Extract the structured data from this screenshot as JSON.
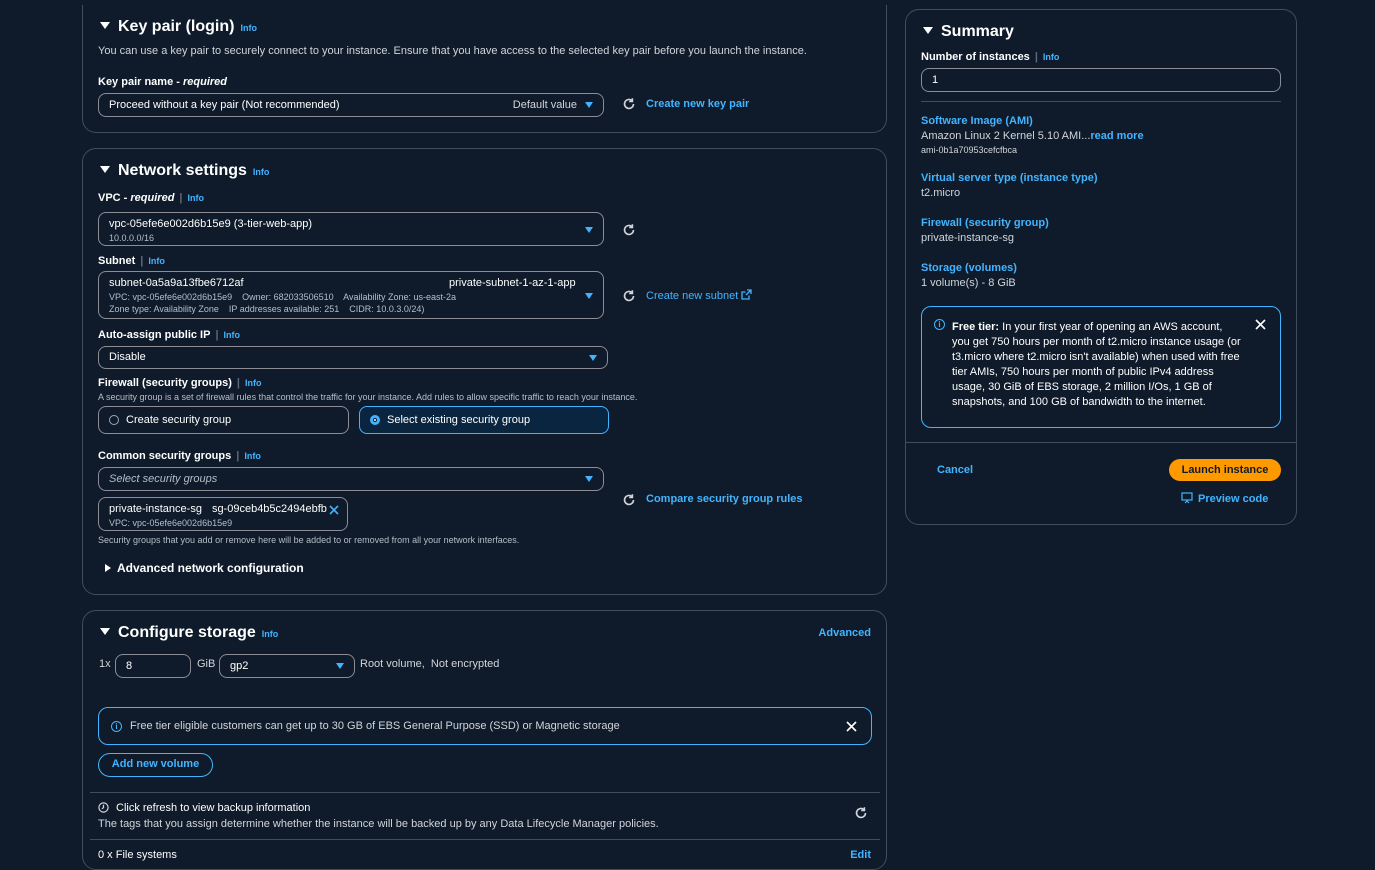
{
  "key_pair": {
    "title": "Key pair (login)",
    "info": "Info",
    "description": "You can use a key pair to securely connect to your instance. Ensure that you have access to the selected key pair before you launch the instance.",
    "name_label": "Key pair name",
    "required": "required",
    "selected": "Proceed without a key pair (Not recommended)",
    "default_tag": "Default value",
    "create_link": "Create new key pair"
  },
  "network": {
    "title": "Network settings",
    "info": "Info",
    "vpc_label": "VPC",
    "required": "required",
    "vpc_value": "vpc-05efe6e002d6b15e9 (3-tier-web-app)",
    "vpc_cidr": "10.0.0.0/16",
    "subnet_label": "Subnet",
    "subnet_id": "subnet-0a5a9a13fbe6712af",
    "subnet_name": "private-subnet-1-az-1-app",
    "subnet_detail1": "VPC: vpc-05efe6e002d6b15e9    Owner: 682033506510    Availability Zone: us-east-2a",
    "subnet_detail2": "Zone type: Availability Zone    IP addresses available: 251    CIDR: 10.0.3.0/24)",
    "create_subnet": "Create new subnet",
    "auto_ip_label": "Auto-assign public IP",
    "auto_ip_value": "Disable",
    "firewall_label": "Firewall (security groups)",
    "firewall_desc": "A security group is a set of firewall rules that control the traffic for your instance. Add rules to allow specific traffic to reach your instance.",
    "create_sg": "Create security group",
    "select_sg": "Select existing security group",
    "common_sg_label": "Common security groups",
    "sg_placeholder": "Select security groups",
    "token_name": "private-instance-sg",
    "token_id": "sg-09ceb4b5c2494ebfb",
    "token_vpc": "VPC: vpc-05efe6e002d6b15e9",
    "compare_link": "Compare security group rules",
    "sg_note": "Security groups that you add or remove here will be added to or removed from all your network interfaces.",
    "advanced": "Advanced network configuration"
  },
  "storage": {
    "title": "Configure storage",
    "info": "Info",
    "advanced": "Advanced",
    "multiplier": "1x",
    "size": "8",
    "unit": "GiB",
    "volume_type": "gp2",
    "root_desc": "Root volume,  Not encrypted",
    "free_tier_note": "Free tier eligible customers can get up to 30 GB of EBS General Purpose (SSD) or Magnetic storage",
    "add_volume": "Add new volume",
    "backup_title": "Click refresh to view backup information",
    "backup_desc": "The tags that you assign determine whether the instance will be backed up by any Data Lifecycle Manager policies.",
    "file_systems": "0 x File systems",
    "edit": "Edit"
  },
  "summary": {
    "title": "Summary",
    "instances_label": "Number of instances",
    "info": "Info",
    "instances_value": "1",
    "ami_label": "Software Image (AMI)",
    "ami_value": "Amazon Linux 2 Kernel 5.10 AMI...",
    "read_more": "read more",
    "ami_id": "ami-0b1a70953cefcfbca",
    "type_label": "Virtual server type (instance type)",
    "type_value": "t2.micro",
    "firewall_label": "Firewall (security group)",
    "firewall_value": "private-instance-sg",
    "storage_label": "Storage (volumes)",
    "storage_value": "1 volume(s) - 8 GiB",
    "free_tier_bold": "Free tier:",
    "free_tier_text": " In your first year of opening an AWS account, you get 750 hours per month of t2.micro instance usage (or t3.micro where t2.micro isn't available) when used with free tier AMIs, 750 hours per month of public IPv4 address usage, 30 GiB of EBS storage, 2 million I/Os, 1 GB of snapshots, and 100 GB of bandwidth to the internet.",
    "cancel": "Cancel",
    "launch": "Launch instance",
    "preview": "Preview code"
  },
  "colors": {
    "background": "#0f1b2a",
    "accent": "#42b4ff",
    "primary_button": "#ff9900",
    "border": "#414d5c"
  }
}
